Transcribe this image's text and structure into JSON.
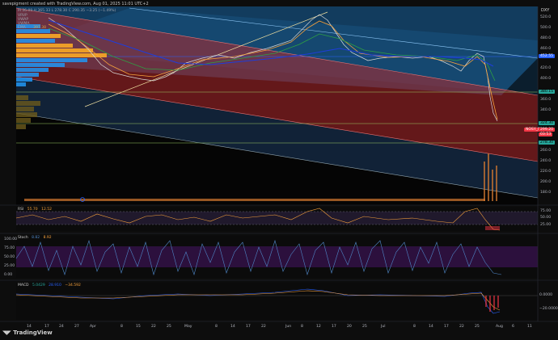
{
  "header": {
    "title": "savepigment created with TradingView.com, Aug 01, 2025 11:01 UTC+2",
    "symbol_tag": "DXY",
    "ticker_line": "M 36.09 H 365.33 L 278.30 C 290.35 −3.25 (−1.49%)"
  },
  "legend": {
    "vpvr": "VRVP",
    "row1": "VWAP",
    "row2": "VWMA",
    "row3": "EMA",
    "row3_value": "397.38"
  },
  "price_axis": {
    "labels": [
      "520.0",
      "500.0",
      "480.0",
      "460.0",
      "440.0",
      "420.0",
      "400.0",
      "380.0",
      "360.0",
      "340.0",
      "320.0",
      "300.0",
      "280.0",
      "260.0",
      "240.0",
      "220.0",
      "200.0",
      "180.0",
      "160.0"
    ],
    "tags": [
      {
        "text": "452.55",
        "color": "#2962ff",
        "fg": "#ffffff"
      },
      {
        "text": "380.15",
        "color": "#26a69a",
        "fg": "#000000"
      },
      {
        "text": "324.30",
        "color": "#26a69a",
        "fg": "#000000"
      },
      {
        "text": "NOSY_B",
        "color": "#f23645",
        "fg": "#ffffff"
      },
      {
        "text": "299.20",
        "color": "#f23645",
        "fg": "#ffffff"
      },
      {
        "text": "03:53",
        "color": "#f23645",
        "fg": "#ffffff"
      },
      {
        "text": "278.30",
        "color": "#26a69a",
        "fg": "#000000"
      }
    ]
  },
  "rsi": {
    "label": "RSI",
    "v1": "55.70",
    "v2": "12.52",
    "axis": [
      "75.00",
      "50.00",
      "25.00"
    ]
  },
  "stoch": {
    "label": "Stoch",
    "v1": "8.82",
    "v2": "8.92",
    "axis": [
      "100.00",
      "75.00",
      "50.00",
      "25.00",
      "0.00"
    ]
  },
  "macd": {
    "label": "MACD",
    "v1": "5.0429",
    "v2": "28.910",
    "v3": "−34.592",
    "axis": [
      "0.0000",
      "−20.0000"
    ]
  },
  "time_axis": [
    "14",
    "17",
    "24",
    "27",
    "Apr",
    "8",
    "15",
    "22",
    "25",
    "May",
    "8",
    "14",
    "17",
    "22",
    "Jun",
    "8",
    "12",
    "17",
    "20",
    "25",
    "Jul",
    "8",
    "14",
    "17",
    "22",
    "25",
    "Aug",
    "6",
    "11"
  ],
  "footer": {
    "brand": "TradingView"
  },
  "colors": {
    "upper_channel": "#1e6aa8",
    "lower_channel": "#b2282c",
    "ema_orange": "#f7a23c",
    "ema_green": "#2ea043",
    "ema_blue": "#1e3ddc"
  }
}
